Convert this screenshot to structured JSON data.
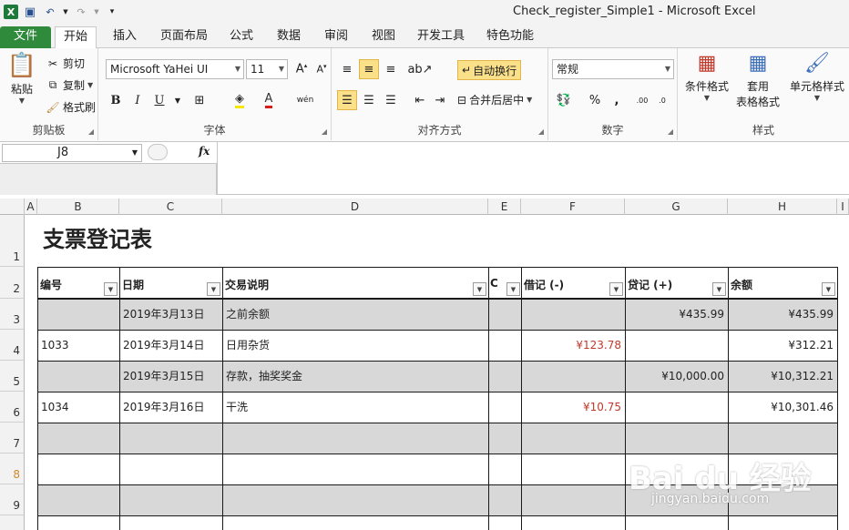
{
  "window": {
    "title": "Check_register_Simple1  -  Microsoft Excel"
  },
  "tabs": [
    "文件",
    "开始",
    "插入",
    "页面布局",
    "公式",
    "数据",
    "审阅",
    "视图",
    "开发工具",
    "特色功能"
  ],
  "ribbon": {
    "clipboard": {
      "paste": "粘贴",
      "cut": "剪切",
      "copy": "复制",
      "format_painter": "格式刷",
      "label": "剪贴板"
    },
    "font": {
      "family": "Microsoft YaHei UI",
      "size": "11",
      "label": "字体"
    },
    "alignment": {
      "wrap": "自动换行",
      "merge": "合并后居中",
      "label": "对齐方式"
    },
    "number": {
      "format": "常规",
      "label": "数字"
    },
    "styles": {
      "conditional": "条件格式",
      "table_line1": "套用",
      "table_line2": "表格格式",
      "cell_styles": "单元格样式",
      "label": "样式"
    }
  },
  "formula_bar": {
    "name_box": "J8",
    "fx": "fx",
    "value": ""
  },
  "columns": [
    "A",
    "B",
    "C",
    "D",
    "E",
    "F",
    "G",
    "H",
    "I"
  ],
  "rows": [
    "1",
    "2",
    "3",
    "4",
    "5",
    "6",
    "7",
    "8",
    "9"
  ],
  "sheet": {
    "title": "支票登记表",
    "headers": [
      "编号",
      "日期",
      "交易说明",
      "C",
      "借记 (-)",
      "贷记 (+)",
      "余额"
    ],
    "records": [
      {
        "num": "",
        "date": "2019年3月13日",
        "desc": "之前余额",
        "c": "",
        "debit": "",
        "credit": "¥435.99",
        "balance": "¥435.99"
      },
      {
        "num": "1033",
        "date": "2019年3月14日",
        "desc": "日用杂货",
        "c": "",
        "debit": "¥123.78",
        "credit": "",
        "balance": "¥312.21"
      },
      {
        "num": "",
        "date": "2019年3月15日",
        "desc": "存款，抽奖奖金",
        "c": "",
        "debit": "",
        "credit": "¥10,000.00",
        "balance": "¥10,312.21"
      },
      {
        "num": "1034",
        "date": "2019年3月16日",
        "desc": "干洗",
        "c": "",
        "debit": "¥10.75",
        "credit": "",
        "balance": "¥10,301.46"
      }
    ]
  },
  "watermark": {
    "brand": "Bai du 经验",
    "url": "jingyan.baidu.com"
  },
  "colors": {
    "file_tab": "#2f8a3c",
    "debit_text": "#c0392b",
    "band": "#d8d8d8"
  }
}
